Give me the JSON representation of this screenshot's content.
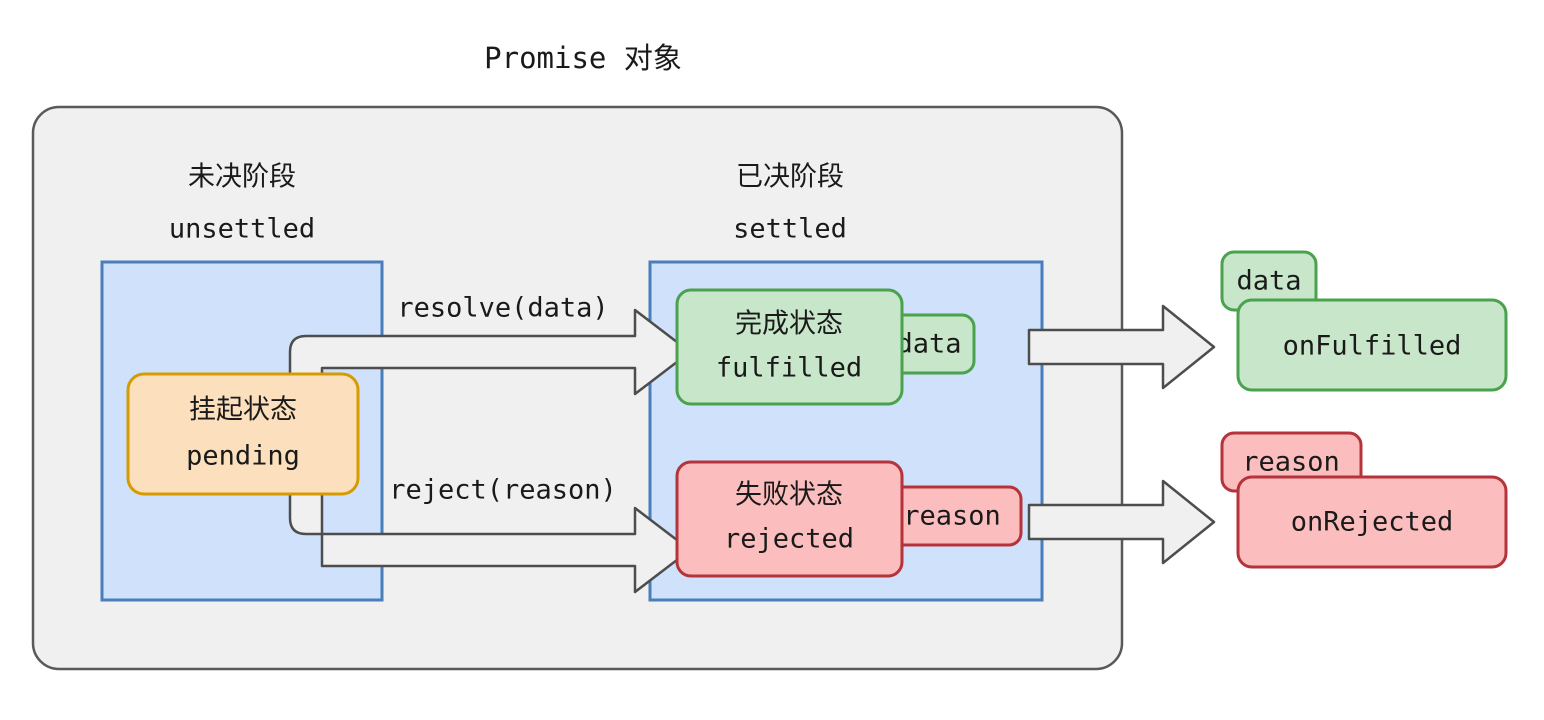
{
  "title": "Promise 对象",
  "phases": {
    "unsettled": {
      "cn": "未决阶段",
      "en": "unsettled"
    },
    "settled": {
      "cn": "已决阶段",
      "en": "settled"
    }
  },
  "states": {
    "pending": {
      "cn": "挂起状态",
      "en": "pending"
    },
    "fulfilled": {
      "cn": "完成状态",
      "en": "fulfilled",
      "tag": "data"
    },
    "rejected": {
      "cn": "失败状态",
      "en": "rejected",
      "tag": "reason"
    }
  },
  "transitions": {
    "resolve": "resolve(data)",
    "reject": "reject(reason)"
  },
  "callbacks": {
    "on_fulfilled": {
      "label": "onFulfilled",
      "tag": "data"
    },
    "on_rejected": {
      "label": "onRejected",
      "tag": "reason"
    }
  },
  "colors": {
    "container_fill": "#f0f0f0",
    "container_stroke": "#595959",
    "phase_fill": "#cfe1fb",
    "phase_stroke": "#4a7ebb",
    "pending_fill": "#fce0bd",
    "pending_stroke": "#d79b00",
    "fulfilled_fill": "#c8e6c9",
    "fulfilled_stroke": "#4aa14e",
    "rejected_fill": "#fbbdbd",
    "rejected_stroke": "#b5333b",
    "arrow_fill": "#f0f0f0",
    "arrow_stroke": "#4d4d4d",
    "text": "#1a1a1a"
  }
}
